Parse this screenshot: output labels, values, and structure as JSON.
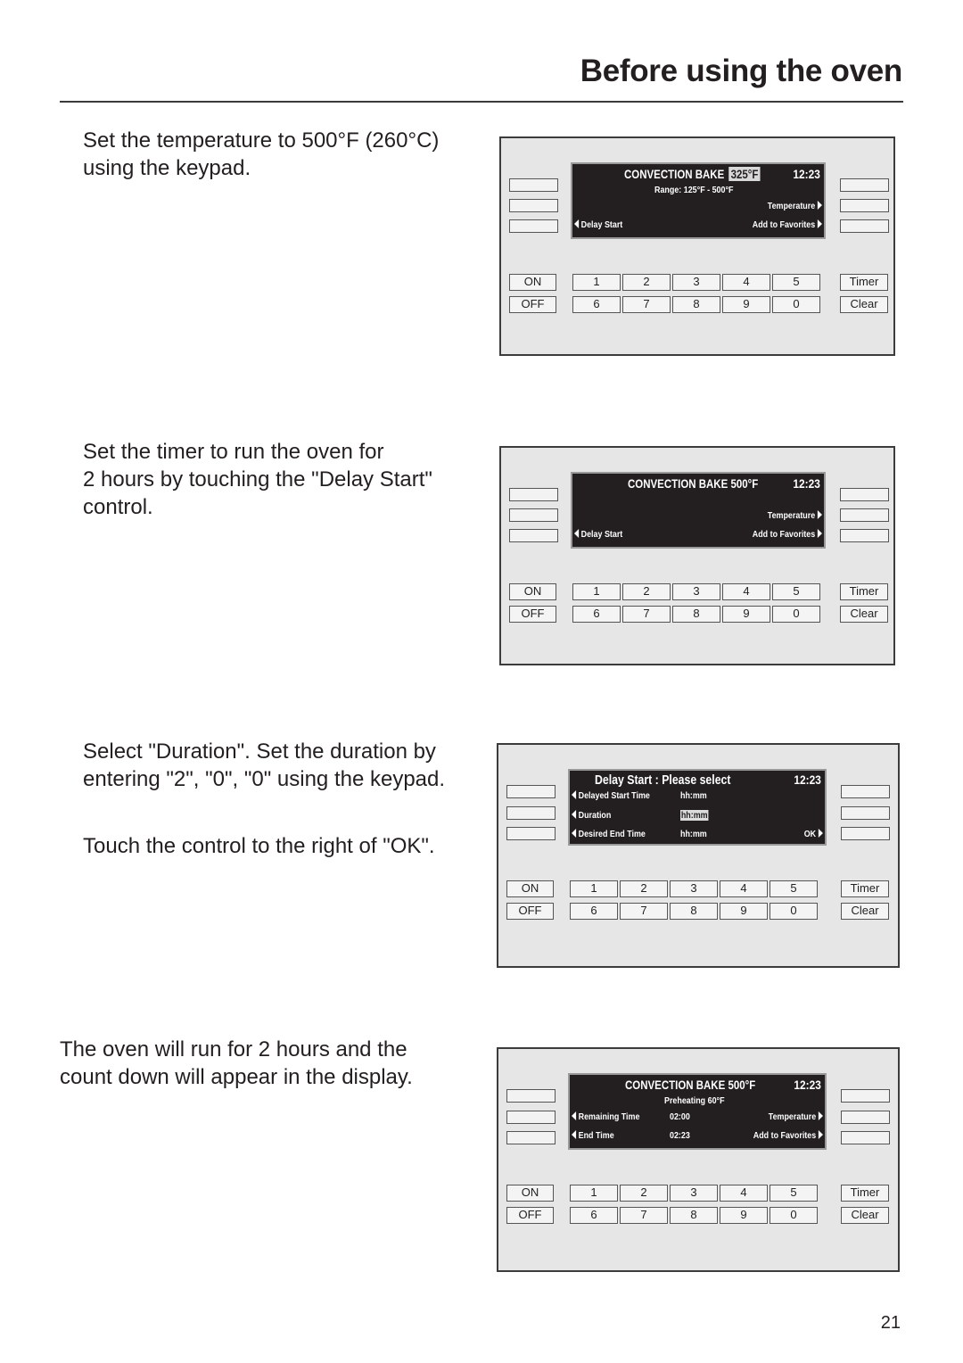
{
  "header": {
    "title": "Before using the oven"
  },
  "page_number": "21",
  "steps": [
    {
      "text": "Set the temperature to 500°F (260°C)\nusing the keypad.",
      "display": {
        "title": "CONVECTION BAKE",
        "temp": "325°F",
        "time": "12:23",
        "subtitle": "Range: 125°F - 500°F",
        "right_1": "Temperature",
        "left_2": "Delay Start",
        "right_2": "Add to Favorites"
      }
    },
    {
      "text": "Set the timer to run the oven for\n2 hours by touching the \"Delay Start\"\ncontrol.",
      "display": {
        "title": "CONVECTION BAKE 500°F",
        "time": "12:23",
        "right_1": "Temperature",
        "left_2": "Delay Start",
        "right_2": "Add to Favorites"
      }
    },
    {
      "text": "Select \"Duration\". Set the duration by\nentering \"2\", \"0\", \"0\" using the keypad.",
      "text2": "Touch the control to the right of \"OK\".",
      "display": {
        "title": "Delay Start : Please select",
        "time": "12:23",
        "rows": [
          {
            "label": "Delayed Start Time",
            "value": "hh:mm"
          },
          {
            "label": "Duration",
            "value": "hh:mm"
          },
          {
            "label": "Desired End Time",
            "value": "hh:mm"
          }
        ],
        "ok": "OK"
      }
    },
    {
      "text": "The oven will run for 2 hours and the\ncount down will appear in the display.",
      "display": {
        "title": "CONVECTION BAKE 500°F",
        "time": "12:23",
        "subtitle": "Preheating 60°F",
        "left_1": "Remaining Time",
        "value_1": "02:00",
        "right_1": "Temperature",
        "left_2": "End Time",
        "value_2": "02:23",
        "right_2": "Add to Favorites"
      }
    }
  ],
  "keypad": {
    "on": "ON",
    "off": "OFF",
    "row1": [
      "1",
      "2",
      "3",
      "4",
      "5"
    ],
    "row2": [
      "6",
      "7",
      "8",
      "9",
      "0"
    ],
    "timer": "Timer",
    "clear": "Clear"
  }
}
